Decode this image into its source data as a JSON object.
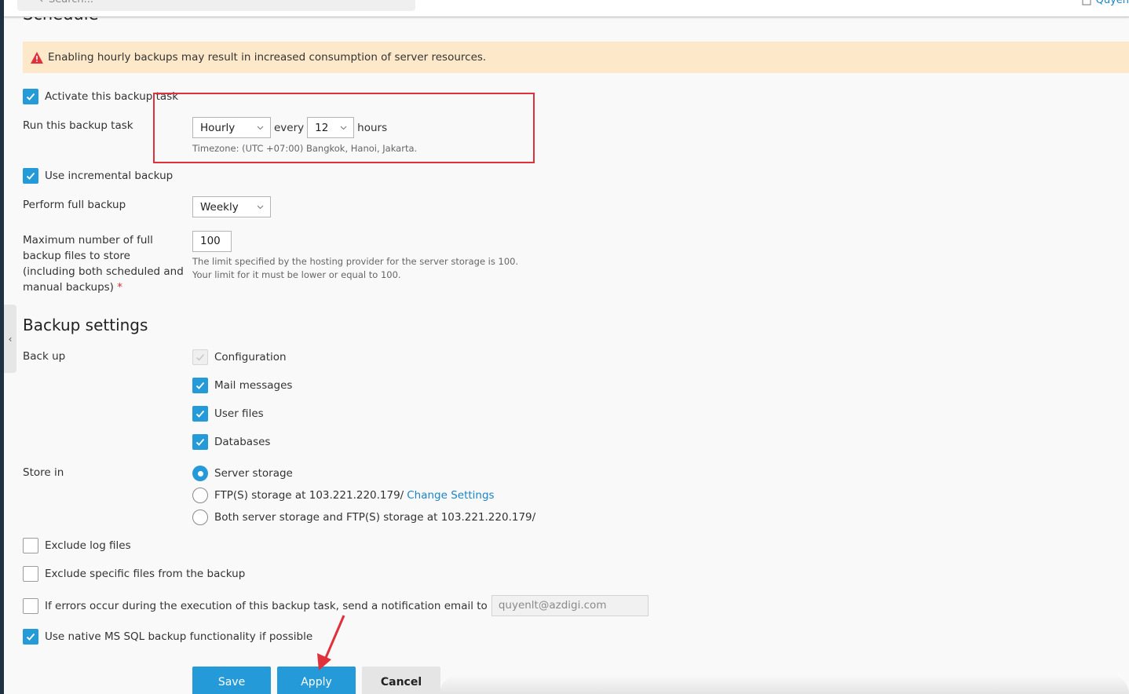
{
  "header": {
    "search_placeholder": "Search...",
    "user_name": "Quyen"
  },
  "schedule": {
    "title": "Schedule",
    "warning": "Enabling hourly backups may result in increased consumption of server resources.",
    "activate_label": "Activate this backup task",
    "activate_checked": true,
    "run_label": "Run this backup task",
    "frequency_value": "Hourly",
    "every_label": "every",
    "interval_value": "12",
    "hours_label": "hours",
    "timezone": "Timezone: (UTC +07:00) Bangkok, Hanoi, Jakarta.",
    "incremental_label": "Use incremental backup",
    "incremental_checked": true,
    "full_backup_label": "Perform full backup",
    "full_backup_value": "Weekly",
    "max_label": "Maximum number of full backup files to store (including both scheduled and manual backups)",
    "max_required_mark": "*",
    "max_value": "100",
    "max_hint_1": "The limit specified by the hosting provider for the server storage is 100.",
    "max_hint_2": "Your limit for it must be lower or equal to 100."
  },
  "backup_settings": {
    "title": "Backup settings",
    "backup_label": "Back up",
    "items": [
      {
        "label": "Configuration",
        "state": "disabled-checked"
      },
      {
        "label": "Mail messages",
        "state": "checked"
      },
      {
        "label": "User files",
        "state": "checked"
      },
      {
        "label": "Databases",
        "state": "checked"
      }
    ],
    "store_label": "Store in",
    "store_options": [
      {
        "label": "Server storage",
        "selected": true
      },
      {
        "label": "FTP(S) storage at 103.221.220.179/",
        "link": "Change Settings",
        "selected": false
      },
      {
        "label": "Both server storage and FTP(S) storage at 103.221.220.179/",
        "selected": false
      }
    ],
    "exclude_log_label": "Exclude log files",
    "exclude_specific_label": "Exclude specific files from the backup",
    "notify_label": "If errors occur during the execution of this backup task, send a notification email to",
    "notify_email": "quyenlt@azdigi.com",
    "mssql_label": "Use native MS SQL backup functionality if possible",
    "mssql_checked": true
  },
  "buttons": {
    "save": "Save",
    "apply": "Apply",
    "cancel": "Cancel"
  },
  "colors": {
    "accent": "#259ad8",
    "warning_bg": "#fde9c9",
    "annotation": "#e0303a",
    "link": "#1a84c6"
  }
}
